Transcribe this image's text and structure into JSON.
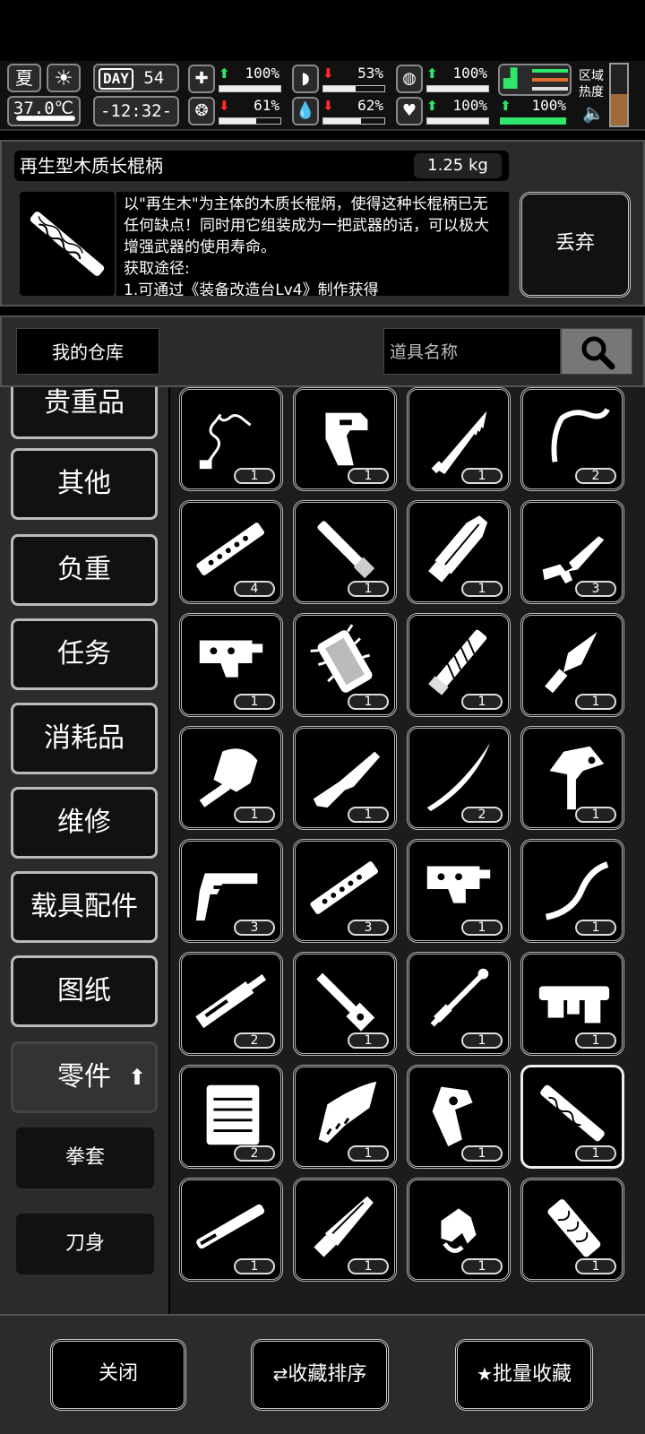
{
  "status": {
    "season": "夏",
    "temperature": "37.0℃",
    "day_label": "DAY",
    "day_number": "54",
    "clock": "-12:32-",
    "stats": [
      {
        "icon": "first-aid-icon",
        "arrow": "up",
        "value": "100%",
        "level": 1.0
      },
      {
        "icon": "stomach-icon",
        "arrow": "down",
        "value": "53%",
        "level": 0.53
      },
      {
        "icon": "lungs-icon",
        "arrow": "up",
        "value": "100%",
        "level": 1.0
      },
      {
        "icon": "brain-icon",
        "arrow": "down",
        "value": "61%",
        "level": 0.61
      },
      {
        "icon": "water-drop-icon",
        "arrow": "down",
        "value": "62%",
        "level": 0.62
      },
      {
        "icon": "heart-icon",
        "arrow": "up",
        "value": "100%",
        "level": 1.0
      }
    ],
    "gear": {
      "icon": "boot-icon",
      "arrow": "up",
      "value": "100%",
      "level": 1.0
    },
    "region_heat_label": "区域热度",
    "region_heat_level": 0.52
  },
  "detail": {
    "title": "再生型木质长棍柄",
    "weight": "1.25 kg",
    "description": "以\"再生木\"为主体的木质长棍炳，使得这种长棍柄已无任何缺点！同时用它组装成为一把武器的话，可以极大增强武器的使用寿命。",
    "source_label": "获取途径:",
    "source_line": "1.可通过《装备改造台Lv4》制作获得",
    "drop_label": "丢弃"
  },
  "warehouse": {
    "title": "我的仓库",
    "search_placeholder": "道具名称"
  },
  "categories": [
    {
      "label": "贵重品"
    },
    {
      "label": "其他"
    },
    {
      "label": "负重"
    },
    {
      "label": "任务"
    },
    {
      "label": "消耗品"
    },
    {
      "label": "维修"
    },
    {
      "label": "载具配件"
    },
    {
      "label": "图纸"
    },
    {
      "label": "零件",
      "active": true
    }
  ],
  "subcategories": [
    {
      "label": "拳套"
    },
    {
      "label": "刀身"
    }
  ],
  "items": [
    {
      "name": "wire-coil-item",
      "count": "1"
    },
    {
      "name": "pistol-grip-item",
      "count": "1"
    },
    {
      "name": "serrated-blade-item",
      "count": "1"
    },
    {
      "name": "hook-item",
      "count": "2"
    },
    {
      "name": "perforated-rail-item",
      "count": "4"
    },
    {
      "name": "short-pole-item",
      "count": "1"
    },
    {
      "name": "broad-blade-item",
      "count": "1"
    },
    {
      "name": "smg-item",
      "count": "3"
    },
    {
      "name": "receiver-item",
      "count": "1"
    },
    {
      "name": "spiked-canister-item",
      "count": "1"
    },
    {
      "name": "wrapped-handle-item",
      "count": "1"
    },
    {
      "name": "dagger-blade-item",
      "count": "1"
    },
    {
      "name": "shovel-head-item",
      "count": "1"
    },
    {
      "name": "shotgun-stock-item",
      "count": "1"
    },
    {
      "name": "katana-blade-item",
      "count": "2"
    },
    {
      "name": "axe-head-item",
      "count": "1"
    },
    {
      "name": "pistol-frame-item",
      "count": "3"
    },
    {
      "name": "perforated-rail-item",
      "count": "3"
    },
    {
      "name": "receiver-item",
      "count": "1"
    },
    {
      "name": "bow-limb-item",
      "count": "1"
    },
    {
      "name": "rifle-barrel-item",
      "count": "2"
    },
    {
      "name": "scope-item",
      "count": "1"
    },
    {
      "name": "rod-assembly-item",
      "count": "1"
    },
    {
      "name": "tool-belt-item",
      "count": "1"
    },
    {
      "name": "file-tray-item",
      "count": "2"
    },
    {
      "name": "knuckle-guard-item",
      "count": "1"
    },
    {
      "name": "revolver-grip-item",
      "count": "1"
    },
    {
      "name": "wooden-staff-handle-item",
      "count": "1",
      "selected": true
    },
    {
      "name": "barrel-item",
      "count": "1"
    },
    {
      "name": "machete-blade-item",
      "count": "1"
    },
    {
      "name": "trigger-item",
      "count": "1"
    },
    {
      "name": "wooden-grip-item",
      "count": "1"
    }
  ],
  "bottom": {
    "close_label": "关闭",
    "sort_label": "收藏排序",
    "batch_label": "批量收藏"
  }
}
